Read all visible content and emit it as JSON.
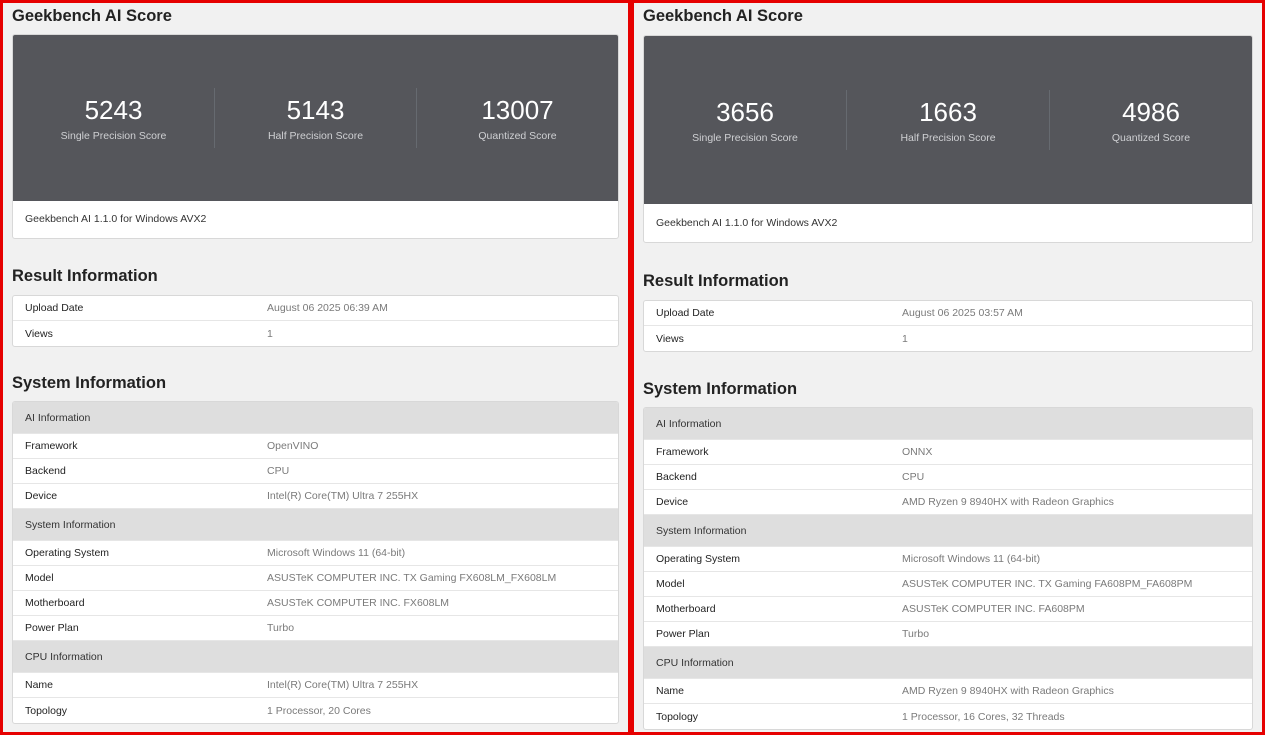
{
  "left": {
    "score_title": "Geekbench AI Score",
    "scores": [
      {
        "value": "5243",
        "label": "Single Precision Score"
      },
      {
        "value": "5143",
        "label": "Half Precision Score"
      },
      {
        "value": "13007",
        "label": "Quantized Score"
      }
    ],
    "version": "Geekbench AI 1.1.0 for Windows AVX2",
    "result_title": "Result Information",
    "result_rows": [
      {
        "key": "Upload Date",
        "value": "August 06 2025 06:39 AM"
      },
      {
        "key": "Views",
        "value": "1"
      }
    ],
    "system_title": "System Information",
    "system_rows": [
      {
        "key": "AI Information",
        "value": "",
        "head": true
      },
      {
        "key": "Framework",
        "value": "OpenVINO"
      },
      {
        "key": "Backend",
        "value": "CPU"
      },
      {
        "key": "Device",
        "value": "Intel(R) Core(TM) Ultra 7 255HX"
      },
      {
        "key": "System Information",
        "value": "",
        "head": true
      },
      {
        "key": "Operating System",
        "value": "Microsoft Windows 11 (64-bit)"
      },
      {
        "key": "Model",
        "value": "ASUSTeK COMPUTER INC. TX Gaming FX608LM_FX608LM"
      },
      {
        "key": "Motherboard",
        "value": "ASUSTeK COMPUTER INC. FX608LM"
      },
      {
        "key": "Power Plan",
        "value": "Turbo"
      },
      {
        "key": "CPU Information",
        "value": "",
        "head": true
      },
      {
        "key": "Name",
        "value": "Intel(R) Core(TM) Ultra 7 255HX"
      },
      {
        "key": "Topology",
        "value": "1 Processor, 20 Cores"
      }
    ]
  },
  "right": {
    "score_title": "Geekbench AI Score",
    "scores": [
      {
        "value": "3656",
        "label": "Single Precision Score"
      },
      {
        "value": "1663",
        "label": "Half Precision Score"
      },
      {
        "value": "4986",
        "label": "Quantized Score"
      }
    ],
    "version": "Geekbench AI 1.1.0 for Windows AVX2",
    "result_title": "Result Information",
    "result_rows": [
      {
        "key": "Upload Date",
        "value": "August 06 2025 03:57 AM"
      },
      {
        "key": "Views",
        "value": "1"
      }
    ],
    "system_title": "System Information",
    "system_rows": [
      {
        "key": "AI Information",
        "value": "",
        "head": true
      },
      {
        "key": "Framework",
        "value": "ONNX"
      },
      {
        "key": "Backend",
        "value": "CPU"
      },
      {
        "key": "Device",
        "value": "AMD Ryzen 9 8940HX with Radeon Graphics"
      },
      {
        "key": "System Information",
        "value": "",
        "head": true
      },
      {
        "key": "Operating System",
        "value": "Microsoft Windows 11 (64-bit)"
      },
      {
        "key": "Model",
        "value": "ASUSTeK COMPUTER INC. TX Gaming FA608PM_FA608PM"
      },
      {
        "key": "Motherboard",
        "value": "ASUSTeK COMPUTER INC. FA608PM"
      },
      {
        "key": "Power Plan",
        "value": "Turbo"
      },
      {
        "key": "CPU Information",
        "value": "",
        "head": true
      },
      {
        "key": "Name",
        "value": "AMD Ryzen 9 8940HX with Radeon Graphics"
      },
      {
        "key": "Topology",
        "value": "1 Processor, 16 Cores, 32 Threads"
      }
    ]
  },
  "colors": {
    "highlight_border": "#e60000",
    "score_background": "#55565b"
  }
}
